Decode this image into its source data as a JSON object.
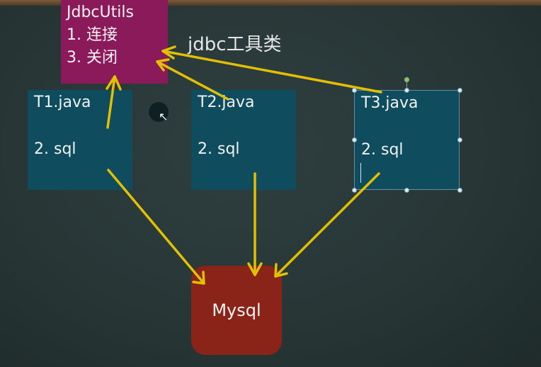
{
  "colors": {
    "utils_box": "#8b1a5b",
    "java_box": "#0e4c5e",
    "mysql_box": "#8a2318",
    "arrow": "#e0c000"
  },
  "utils": {
    "title": "JdbcUtils",
    "line1": "1. 连接",
    "line2": "3. 关闭"
  },
  "tool_label": "jdbc工具类",
  "java_files": [
    {
      "name": "T1.java",
      "sql": "2. sql"
    },
    {
      "name": "T2.java",
      "sql": "2. sql"
    },
    {
      "name": "T3.java",
      "sql": "2. sql"
    }
  ],
  "mysql": {
    "label": "Mysql"
  }
}
